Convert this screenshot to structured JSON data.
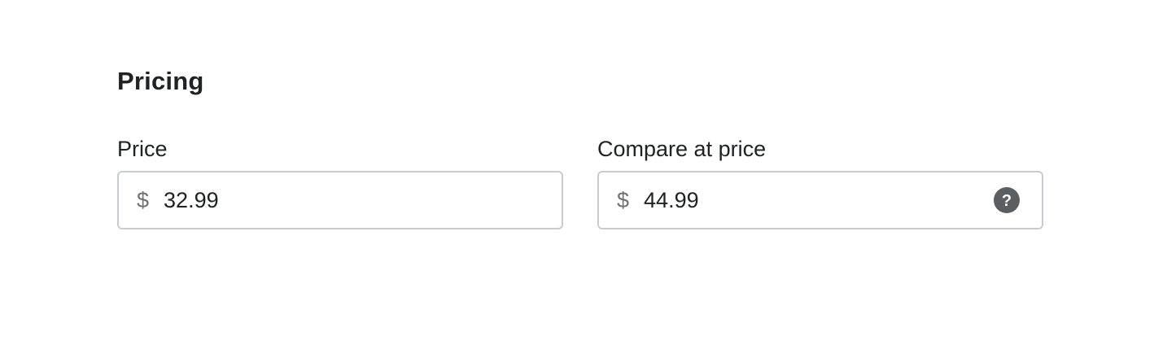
{
  "pricing": {
    "title": "Pricing",
    "price": {
      "label": "Price",
      "prefix": "$",
      "value": "32.99"
    },
    "compare_at_price": {
      "label": "Compare at price",
      "prefix": "$",
      "value": "44.99",
      "icon": "question-circle-icon"
    }
  },
  "colors": {
    "text": "#202223",
    "muted": "#6d7175",
    "border": "#c9cccf",
    "icon": "#5c5f62"
  }
}
